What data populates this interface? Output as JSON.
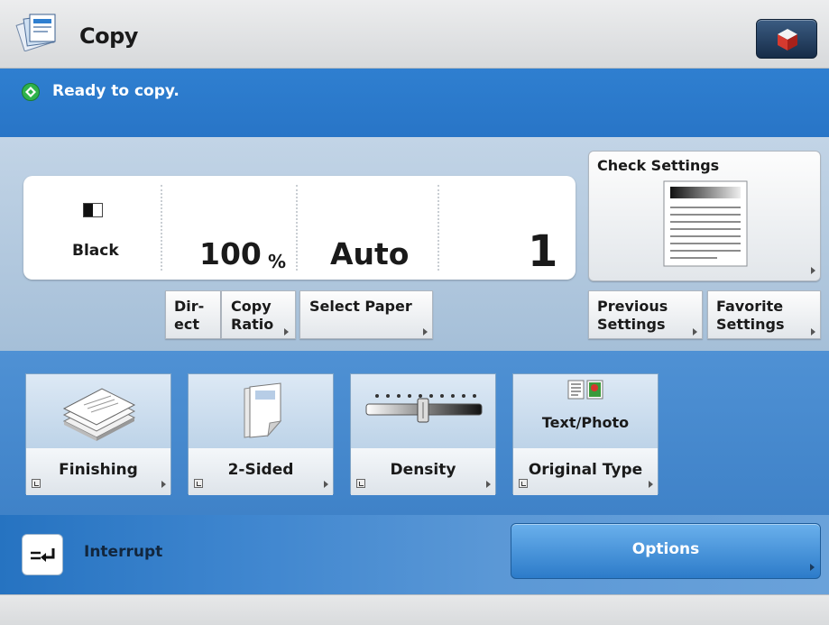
{
  "title": "Copy",
  "status": {
    "text": "Ready to copy."
  },
  "settings": {
    "color_mode": "Black",
    "copy_ratio_value": "100",
    "copy_ratio_unit": "%",
    "paper_value": "Auto",
    "copies_value": "1"
  },
  "buttons": {
    "direct_line1": "Dir-",
    "direct_line2": "ect",
    "copy_ratio_line1": "Copy",
    "copy_ratio_line2": "Ratio",
    "select_paper": "Select Paper",
    "check_settings": "Check Settings",
    "previous_line1": "Previous",
    "previous_line2": "Settings",
    "favorite_line1": "Favorite",
    "favorite_line2": "Settings"
  },
  "functions": [
    {
      "label": "Finishing"
    },
    {
      "label": "2-Sided"
    },
    {
      "label": "Density"
    },
    {
      "label": "Original Type",
      "value": "Text/Photo"
    }
  ],
  "bottom": {
    "interrupt": "Interrupt",
    "options": "Options"
  },
  "colors": {
    "status_blue": "#2f7fd0",
    "settings_bg": "#b3c9df",
    "function_blue": "#4f91d4",
    "options_blue": "#3d8ad6",
    "ready_green": "#2fb24c",
    "top_button_navy": "#1f3a5c"
  },
  "icons": {
    "app": "copy-documents-icon",
    "top_button": "red-cube-icon",
    "status": "green-diamond-icon",
    "color_mode": "black-white-icon",
    "check_settings": "document-preview-icon",
    "finishing": "paper-stack-icon",
    "two_sided": "duplex-page-icon",
    "density": "density-slider-icon",
    "original_type": "text-photo-icon",
    "interrupt": "interrupt-arrows-icon"
  }
}
